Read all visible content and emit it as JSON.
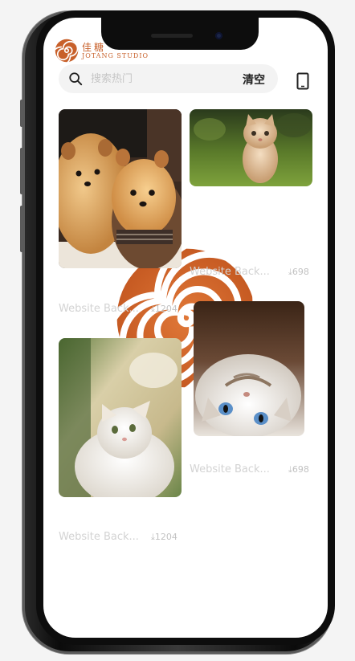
{
  "header": {
    "logo_cn": "佳糖",
    "logo_en": "JOTANG STUDIO"
  },
  "search": {
    "placeholder": "搜索热门",
    "value": "",
    "clear_label": "清空"
  },
  "cards": [
    {
      "title": "Website Back...",
      "downloads": "698",
      "image": "two-pomeranians"
    },
    {
      "title": "Website Back...",
      "downloads": "1204",
      "image": "kitten-on-grass"
    },
    {
      "title": "Website Back...",
      "downloads": "698",
      "image": "kitten-upside-down"
    },
    {
      "title": "Website Back...",
      "downloads": "1204",
      "image": "white-cat-looking-up"
    }
  ],
  "colors": {
    "accent": "#c8602a",
    "meta_text": "#d3d3d3"
  }
}
